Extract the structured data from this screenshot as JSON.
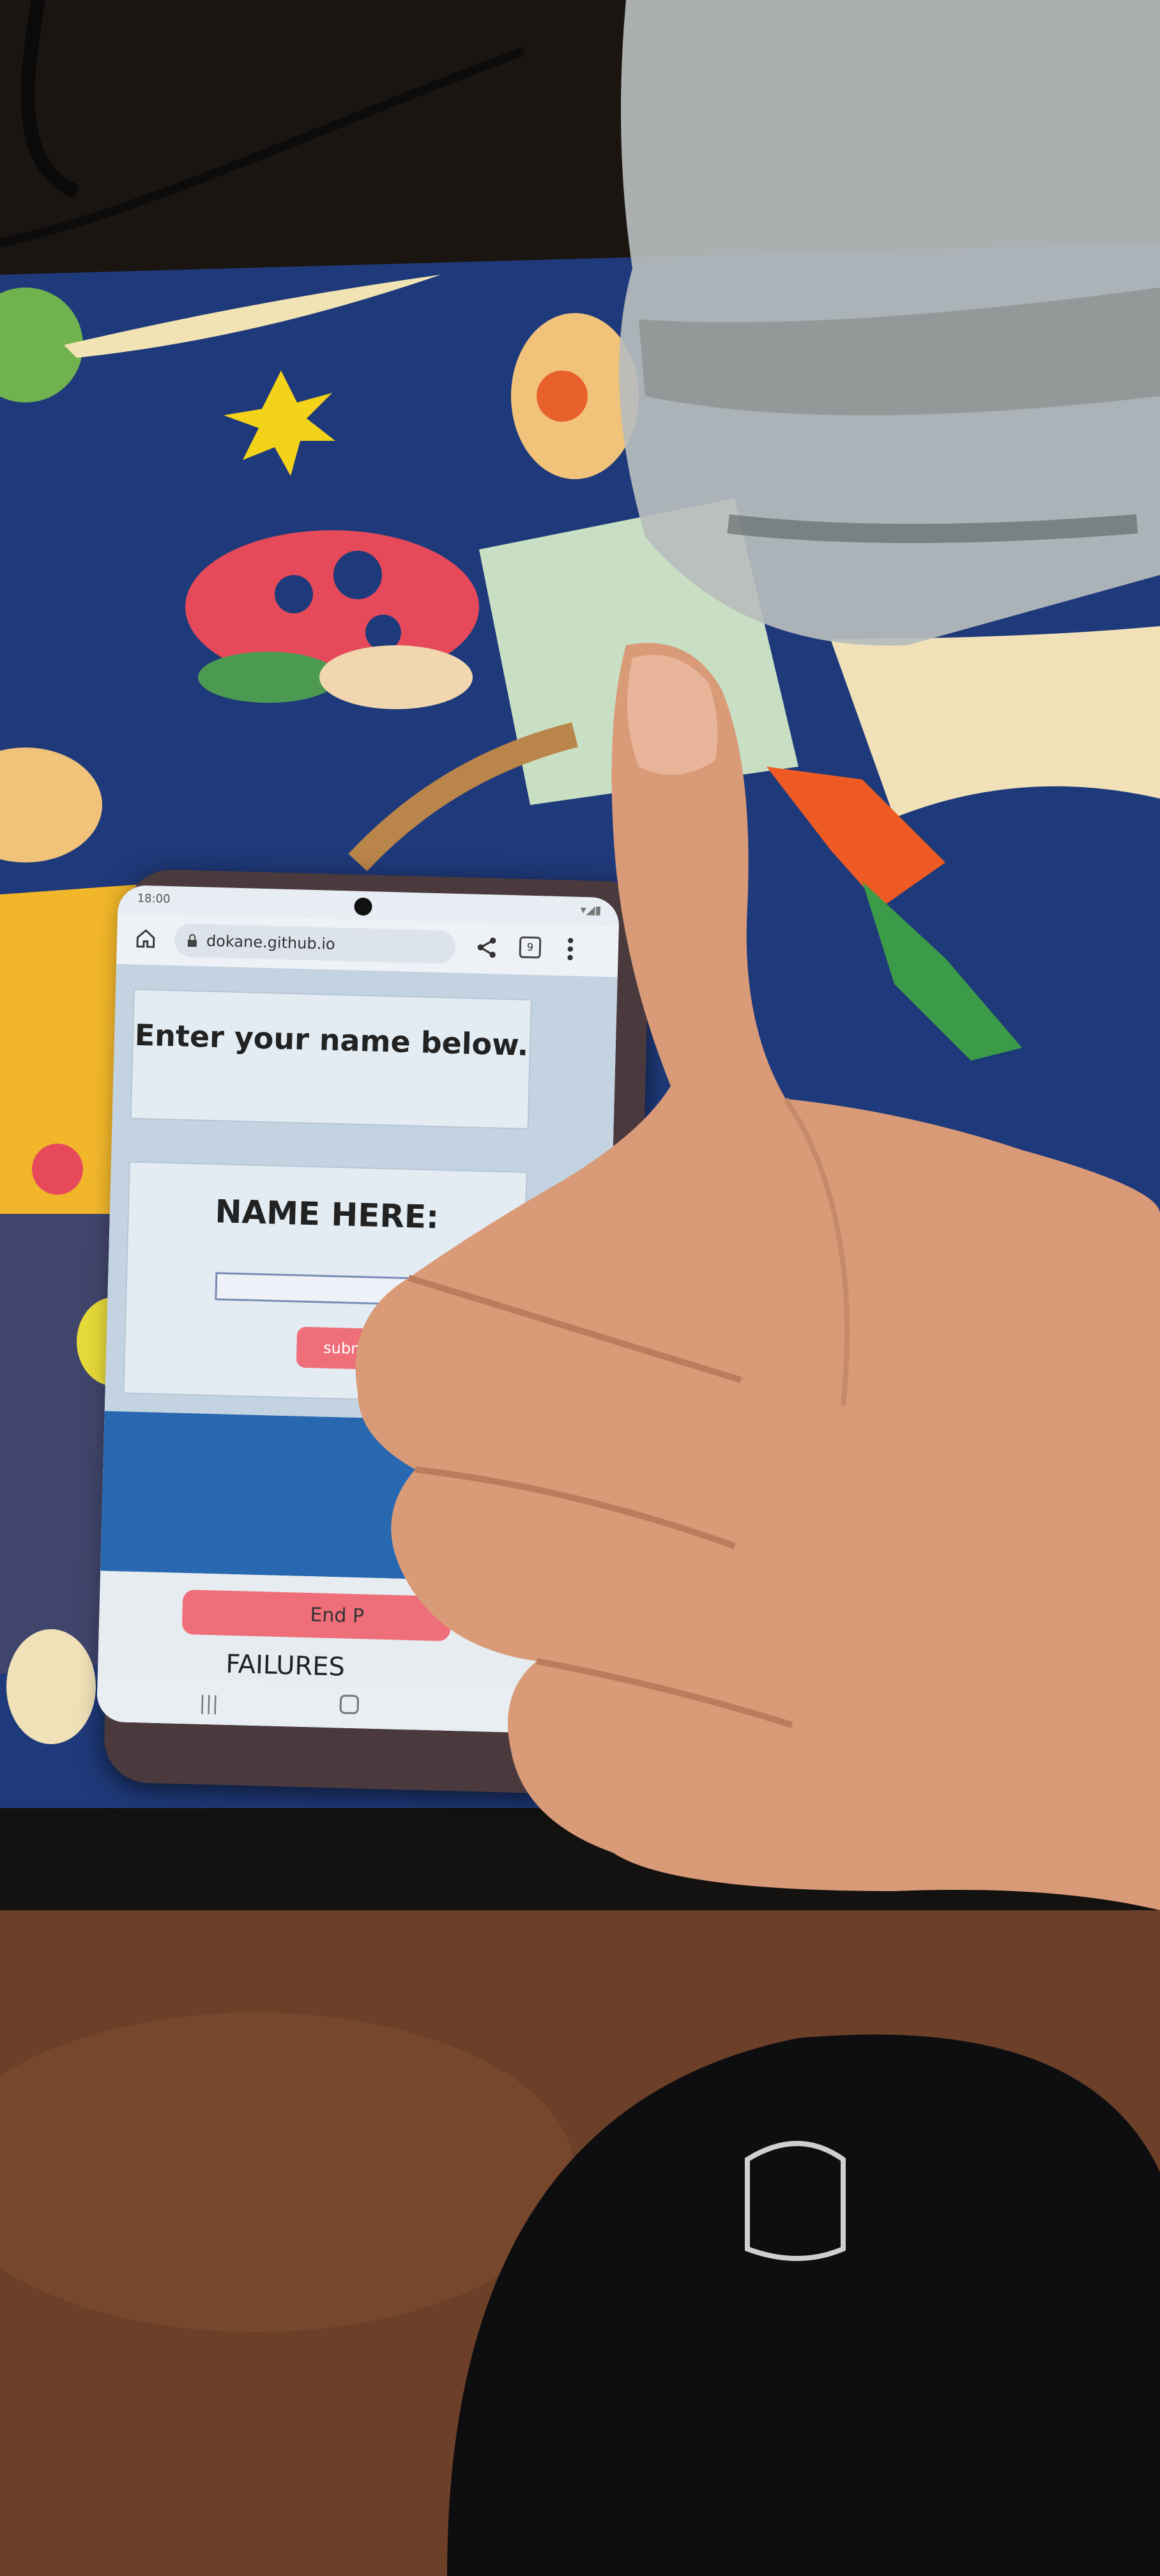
{
  "phone": {
    "status_time": "18:00",
    "url": "dokane.github.io",
    "tab_count": "9"
  },
  "page": {
    "heading": "Enter your name below.",
    "form_title": "NAME HERE:",
    "name_input_value": "",
    "submit_label": "subm",
    "end_button_label": "End P",
    "failures_label": "FAILURES"
  },
  "colors": {
    "accent_button": "#ee6f7a",
    "panel_blue": "#2868b0",
    "mousepad_blue": "#1f3a7a",
    "skin": "#d99a78"
  },
  "icons": [
    "home-icon",
    "lock-icon",
    "share-icon",
    "tabs-icon",
    "menu-icon",
    "recent-apps-icon",
    "nav-home-icon"
  ]
}
